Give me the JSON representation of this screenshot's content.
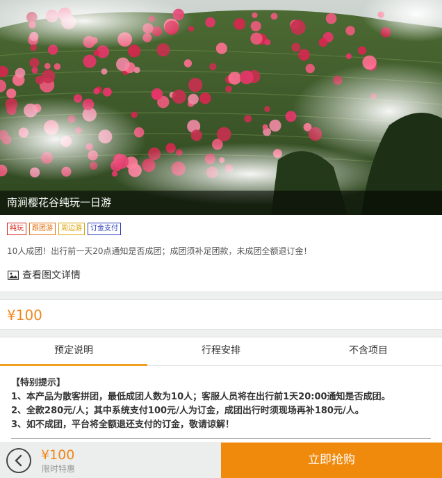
{
  "hero": {
    "caption": "南涧樱花谷纯玩一日游",
    "image": "cherry-blossom-tea-hillside-photo"
  },
  "tags": [
    {
      "label": "纯玩",
      "color": "#d7261e"
    },
    {
      "label": "跟团游",
      "color": "#e0700f"
    },
    {
      "label": "周边游",
      "color": "#d9a400"
    },
    {
      "label": "订金支付",
      "color": "#2a3bb8"
    }
  ],
  "info": {
    "description": "10人成团！出行前一天20点通知是否成团；成团须补足团款，未成团全额退订金！",
    "detail_link": "查看图文详情",
    "detail_icon": "image-icon"
  },
  "price": {
    "value": "¥100",
    "color": "#f08519"
  },
  "tabs": [
    {
      "label": "预定说明",
      "active": true
    },
    {
      "label": "行程安排",
      "active": false
    },
    {
      "label": "不含项目",
      "active": false
    }
  ],
  "notice": {
    "title": "【特别提示】",
    "lines": [
      "1、本产品为散客拼团，最低成团人数为10人；客服人员将在出行前1天20:00通知是否成团。",
      "2、全款280元/人；其中系统支付100元/人为订金，成团出行时须现场再补180元/人。",
      "3、如不成团，平台将全额退还支付的订金，敬请谅解！"
    ]
  },
  "bottom_bar": {
    "back_icon": "chevron-left-icon",
    "price": "¥100",
    "price_note": "限时特惠",
    "buy_label": "立即抢购",
    "buy_color": "#f08a0c"
  }
}
